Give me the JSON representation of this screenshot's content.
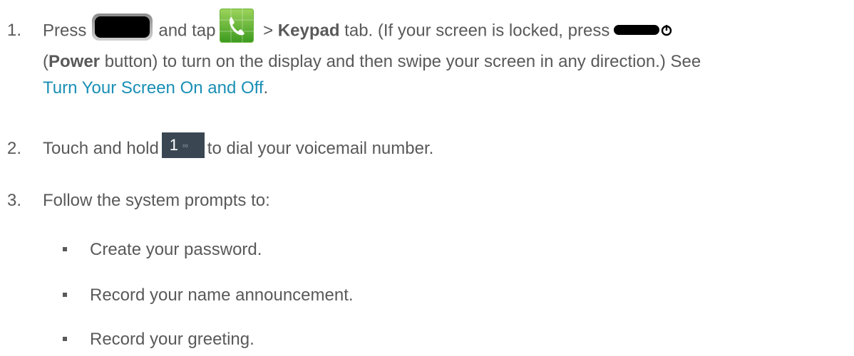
{
  "steps": [
    {
      "number": "1.",
      "text_press": "Press",
      "text_and_tap": "and tap",
      "text_gt": ">",
      "keypad_bold": "Keypad",
      "text_after_keypad": "tab. (If your screen is locked, press",
      "text_open_paren": "(",
      "power_bold": "Power",
      "text_after_power": "button) to turn on the display and then swipe your screen in any direction.) See",
      "link": "Turn Your Screen On and Off",
      "text_period": "."
    },
    {
      "number": "2.",
      "text_before": "Touch and hold",
      "key_digit": "1",
      "text_after": "to dial your voicemail number."
    },
    {
      "number": "3.",
      "text": "Follow the system prompts to:"
    }
  ],
  "bullets": [
    "Create your password.",
    "Record your name announcement.",
    "Record your greeting."
  ],
  "icons": {
    "home": "home-key-icon",
    "phone": "phone-app-icon",
    "power": "power-key-icon",
    "voicemail": "voicemail-key-icon"
  },
  "colors": {
    "text": "#595959",
    "link": "#1a8fb5"
  }
}
